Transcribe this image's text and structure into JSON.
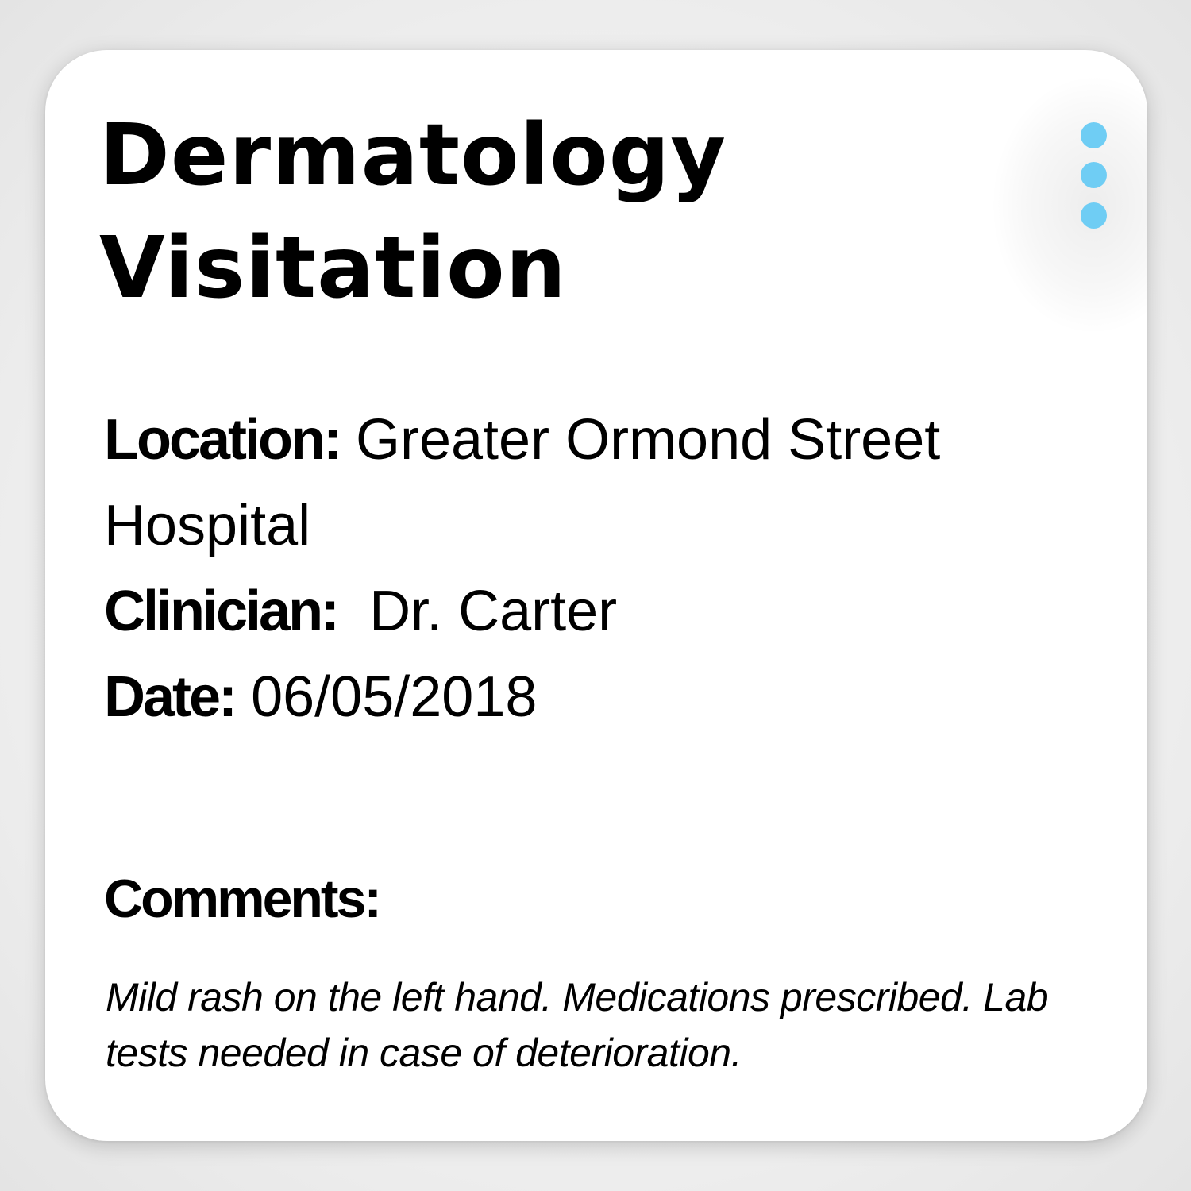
{
  "card": {
    "title_line1": "Dermatology",
    "title_line2": "Visitation",
    "menu_icon": "more-vertical-icon",
    "accent_color": "#6fcdf4"
  },
  "details": {
    "location_label": "Location:",
    "location_value": "Greater Ormond Street Hospital",
    "clinician_label": "Clinician:",
    "clinician_value": "Dr. Carter",
    "date_label": "Date:",
    "date_value": "06/05/2018"
  },
  "comments": {
    "label": "Comments:",
    "text": "Mild rash on the left hand. Medications prescribed. Lab tests needed in case of deterioration."
  }
}
